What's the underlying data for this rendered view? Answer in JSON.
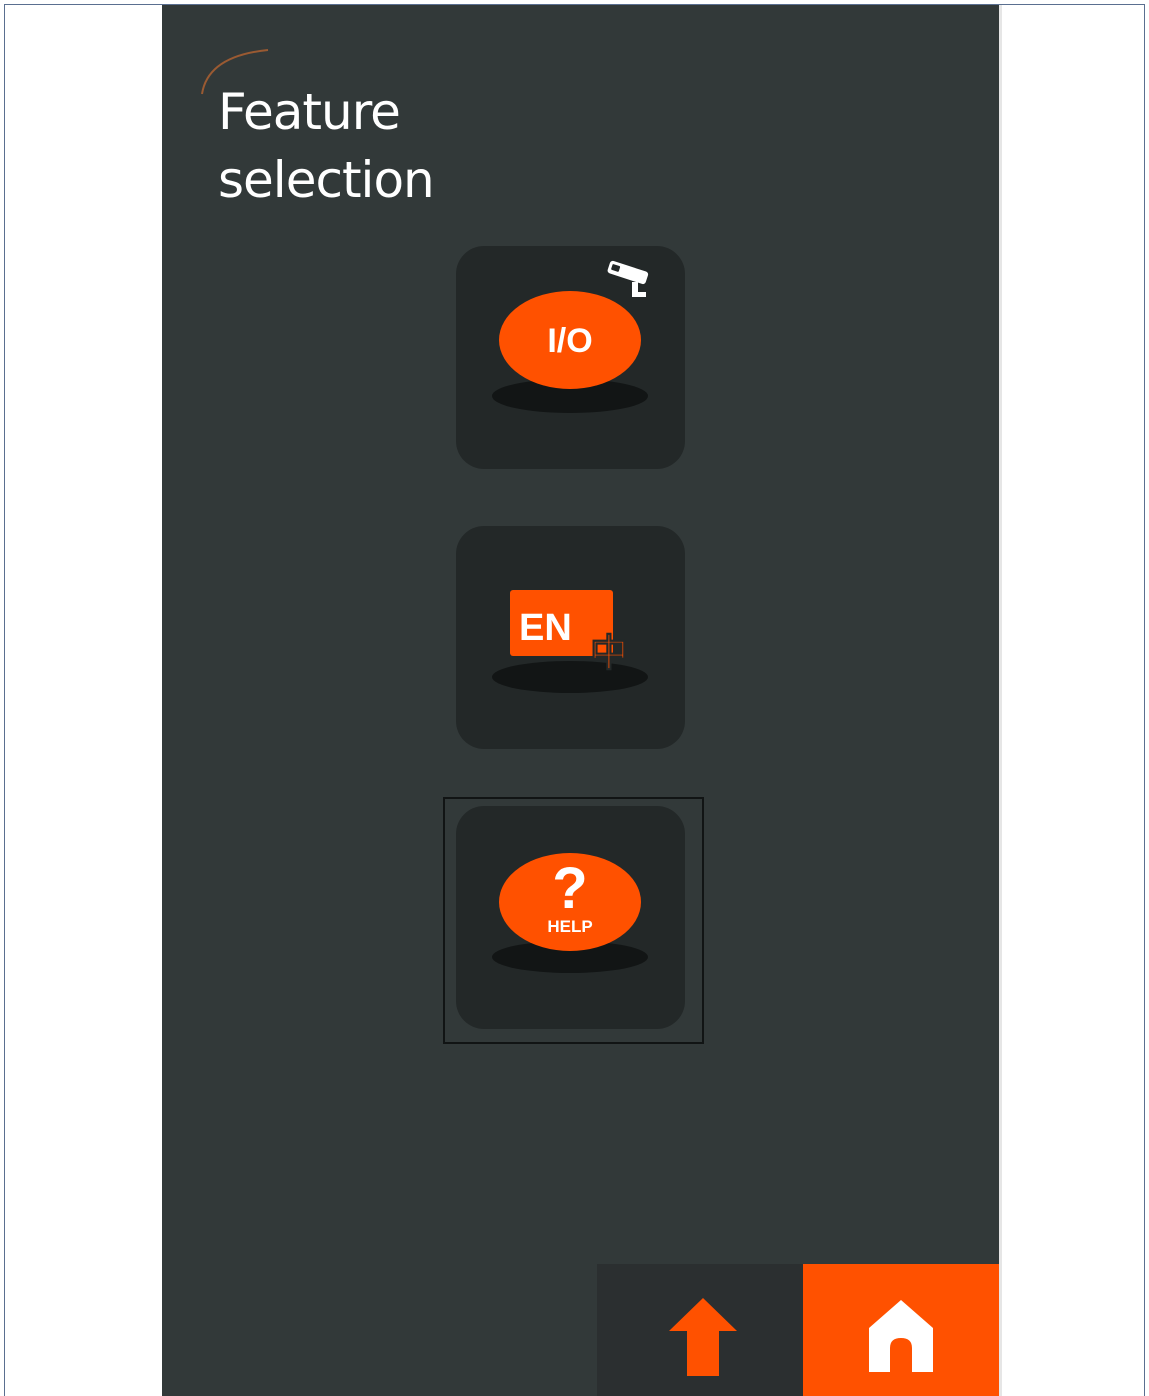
{
  "page": {
    "title_line1": "Feature",
    "title_line2": "selection"
  },
  "features": [
    {
      "id": "io",
      "label": "I/O",
      "badge_icon": "cctv-camera-icon"
    },
    {
      "id": "language",
      "label": "EN",
      "secondary_label": "中",
      "icon": "language-switch-icon"
    },
    {
      "id": "help",
      "label": "?",
      "sub_label": "HELP",
      "icon": "help-icon",
      "focused": true
    }
  ],
  "navigation": {
    "up_icon": "arrow-up-icon",
    "home_icon": "home-icon"
  },
  "colors": {
    "accent": "#ff5100",
    "panel_bg": "#323939",
    "tile_bg": "#232828",
    "text": "#ffffff"
  }
}
